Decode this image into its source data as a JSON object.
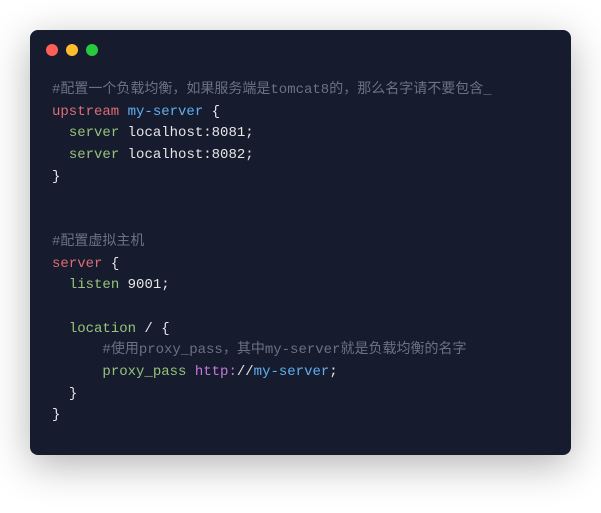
{
  "window": {
    "dots": [
      "red",
      "yellow",
      "green"
    ]
  },
  "code": {
    "l1_comment": "#配置一个负载均衡，如果服务端是tomcat8的，那么名字请不要包含_",
    "l2_kw": "upstream",
    "l2_ident": "my-server",
    "l2_brace": " {",
    "l3_indent": "  ",
    "l3_key": "server",
    "l3_val": " localhost:8081;",
    "l4_indent": "  ",
    "l4_key": "server",
    "l4_val": " localhost:8082;",
    "l5_brace": "}",
    "l6_blank": "",
    "l7_blank": "",
    "l8_comment": "#配置虚拟主机",
    "l9_kw": "server",
    "l9_brace": " {",
    "l10_indent": "  ",
    "l10_key": "listen",
    "l10_val": " 9001;",
    "l11_blank": "",
    "l12_indent": "  ",
    "l12_key": "location",
    "l12_path": " / ",
    "l12_brace": "{",
    "l13_indent": "      ",
    "l13_comment": "#使用proxy_pass，其中my-server就是负载均衡的名字",
    "l14_indent": "      ",
    "l14_key": "proxy_pass",
    "l14_space": " ",
    "l14_scheme": "http:",
    "l14_sep": "//",
    "l14_host": "my-server",
    "l14_semi": ";",
    "l15_indent": "  ",
    "l15_brace": "}",
    "l16_brace": "}"
  }
}
